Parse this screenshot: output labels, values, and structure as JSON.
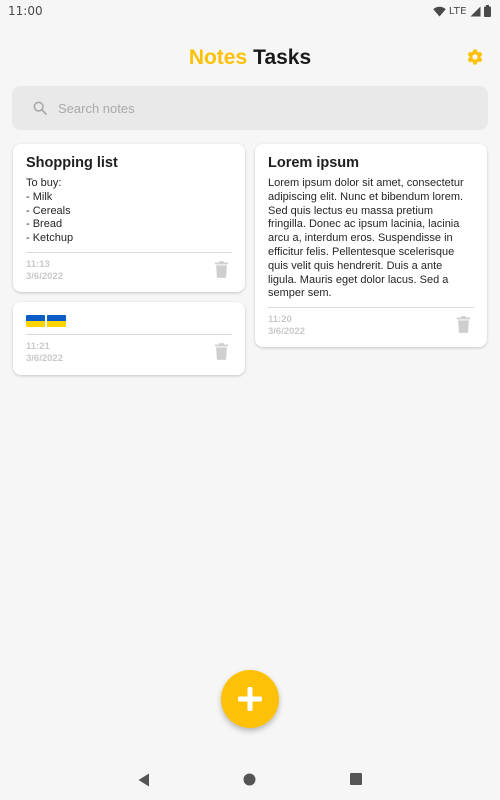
{
  "status_bar": {
    "time": "11:00",
    "network": "LTE",
    "icons": [
      "wifi-icon",
      "signal-icon",
      "battery-icon"
    ]
  },
  "header": {
    "tabs": [
      {
        "label": "Notes",
        "active": true
      },
      {
        "label": "Tasks",
        "active": false
      }
    ],
    "settings_icon": "gear-icon"
  },
  "search": {
    "placeholder": "Search notes",
    "value": "",
    "icon": "search-icon"
  },
  "notes": [
    {
      "title": "Shopping list",
      "body": "To buy:\n- Milk\n- Cereals\n- Bread\n- Ketchup",
      "time": "11:13",
      "date": "3/6/2022"
    },
    {
      "title": "",
      "body_emoji": [
        "ukraine-flag",
        "ukraine-flag"
      ],
      "time": "11:21",
      "date": "3/6/2022"
    },
    {
      "title": "Lorem ipsum",
      "body": "Lorem ipsum dolor sit amet, consectetur adipiscing elit. Nunc et bibendum lorem. Sed quis lectus eu massa pretium fringilla. Donec ac ipsum lacinia, lacinia arcu a, interdum eros. Suspendisse in efficitur felis. Pellentesque scelerisque quis velit quis hendrerit. Duis a ante ligula. Mauris eget dolor lacus. Sed a semper sem.",
      "time": "11:20",
      "date": "3/6/2022"
    }
  ],
  "fab": {
    "icon": "plus-icon"
  },
  "colors": {
    "accent": "#ffc107",
    "background": "#f6f6f6",
    "card": "#ffffff",
    "meta_text": "#c9c9c9",
    "flag_blue": "#0a5cc6",
    "flag_yellow": "#ffd400"
  },
  "nav_bar": {
    "icons": [
      "back-icon",
      "home-icon",
      "recents-icon"
    ]
  }
}
